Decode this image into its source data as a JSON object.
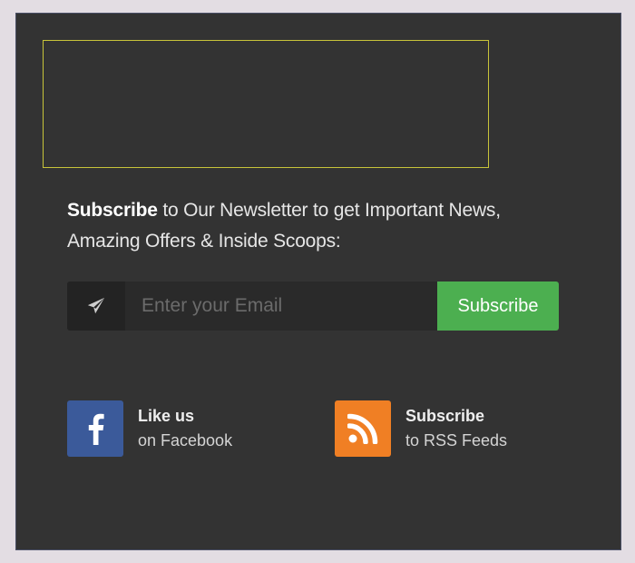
{
  "newsletter": {
    "intro_bold": "Subscribe",
    "intro_rest": " to Our Newsletter to get Important News, Amazing Offers & Inside Scoops:",
    "email_placeholder": "Enter your Email",
    "email_value": "",
    "subscribe_label": "Subscribe"
  },
  "social": {
    "facebook": {
      "title": "Like us",
      "subtitle": "on Facebook",
      "icon": "facebook-icon",
      "color": "#3b5a9a"
    },
    "rss": {
      "title": "Subscribe",
      "subtitle": "to RSS Feeds",
      "icon": "rss-icon",
      "color": "#f07f24"
    }
  },
  "colors": {
    "panel_bg": "#333333",
    "accent_green": "#4caf50",
    "ad_border": "#c8c43a"
  }
}
